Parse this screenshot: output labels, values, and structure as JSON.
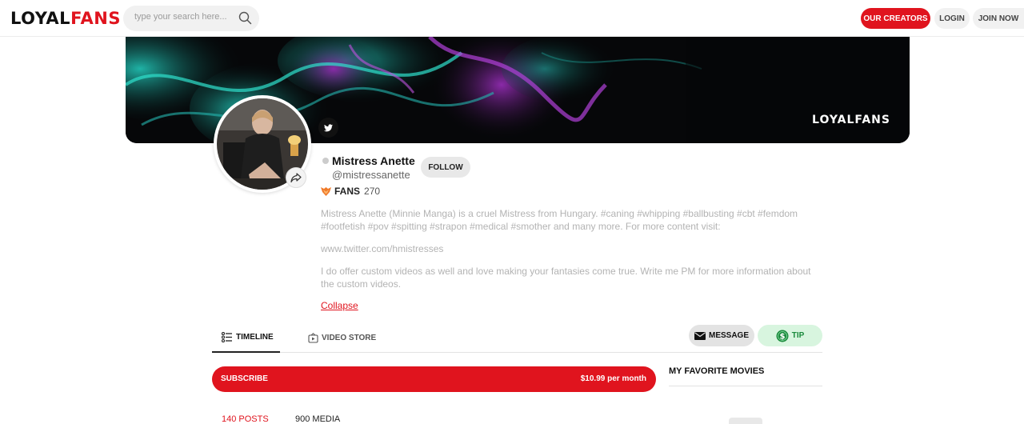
{
  "header": {
    "logo_part1": "LOYAL",
    "logo_part2": "FANS",
    "search_placeholder": "type your search here...",
    "nav": {
      "creators": "OUR CREATORS",
      "login": "LOGIN",
      "join": "JOIN NOW"
    }
  },
  "banner": {
    "watermark": "LOYALFANS"
  },
  "profile": {
    "name": "Mistress Anette",
    "handle": "@mistressanette",
    "follow_label": "FOLLOW",
    "fans_label": "FANS",
    "fans_count": "270",
    "bio": [
      "Mistress Anette (Minnie Manga) is a cruel Mistress from Hungary. #caning #whipping #ballbusting #cbt #femdom #footfetish #pov #spitting #strapon #medical #smother and many more. For more content visit:",
      "www.twitter.com/hmistresses",
      "I do offer custom videos as well and love making your fantasies come true. Write me PM for more information about the custom videos."
    ],
    "collapse_label": "Collapse"
  },
  "tabs": {
    "timeline": "TIMELINE",
    "video_store": "VIDEO STORE",
    "message": "MESSAGE",
    "tip": "TIP"
  },
  "subscribe": {
    "label": "SUBSCRIBE",
    "price": "$10.99 per month"
  },
  "sidebar": {
    "favorites_title": "MY FAVORITE MOVIES"
  },
  "stats": {
    "posts": "140 POSTS",
    "media": "900 MEDIA"
  },
  "colors": {
    "brand": "#e0141e",
    "tip_green": "#1a8a3c"
  },
  "icons": [
    "search-icon",
    "twitter-icon",
    "share-icon",
    "fans-icon",
    "timeline-icon",
    "video-store-icon",
    "message-icon",
    "tip-icon"
  ]
}
